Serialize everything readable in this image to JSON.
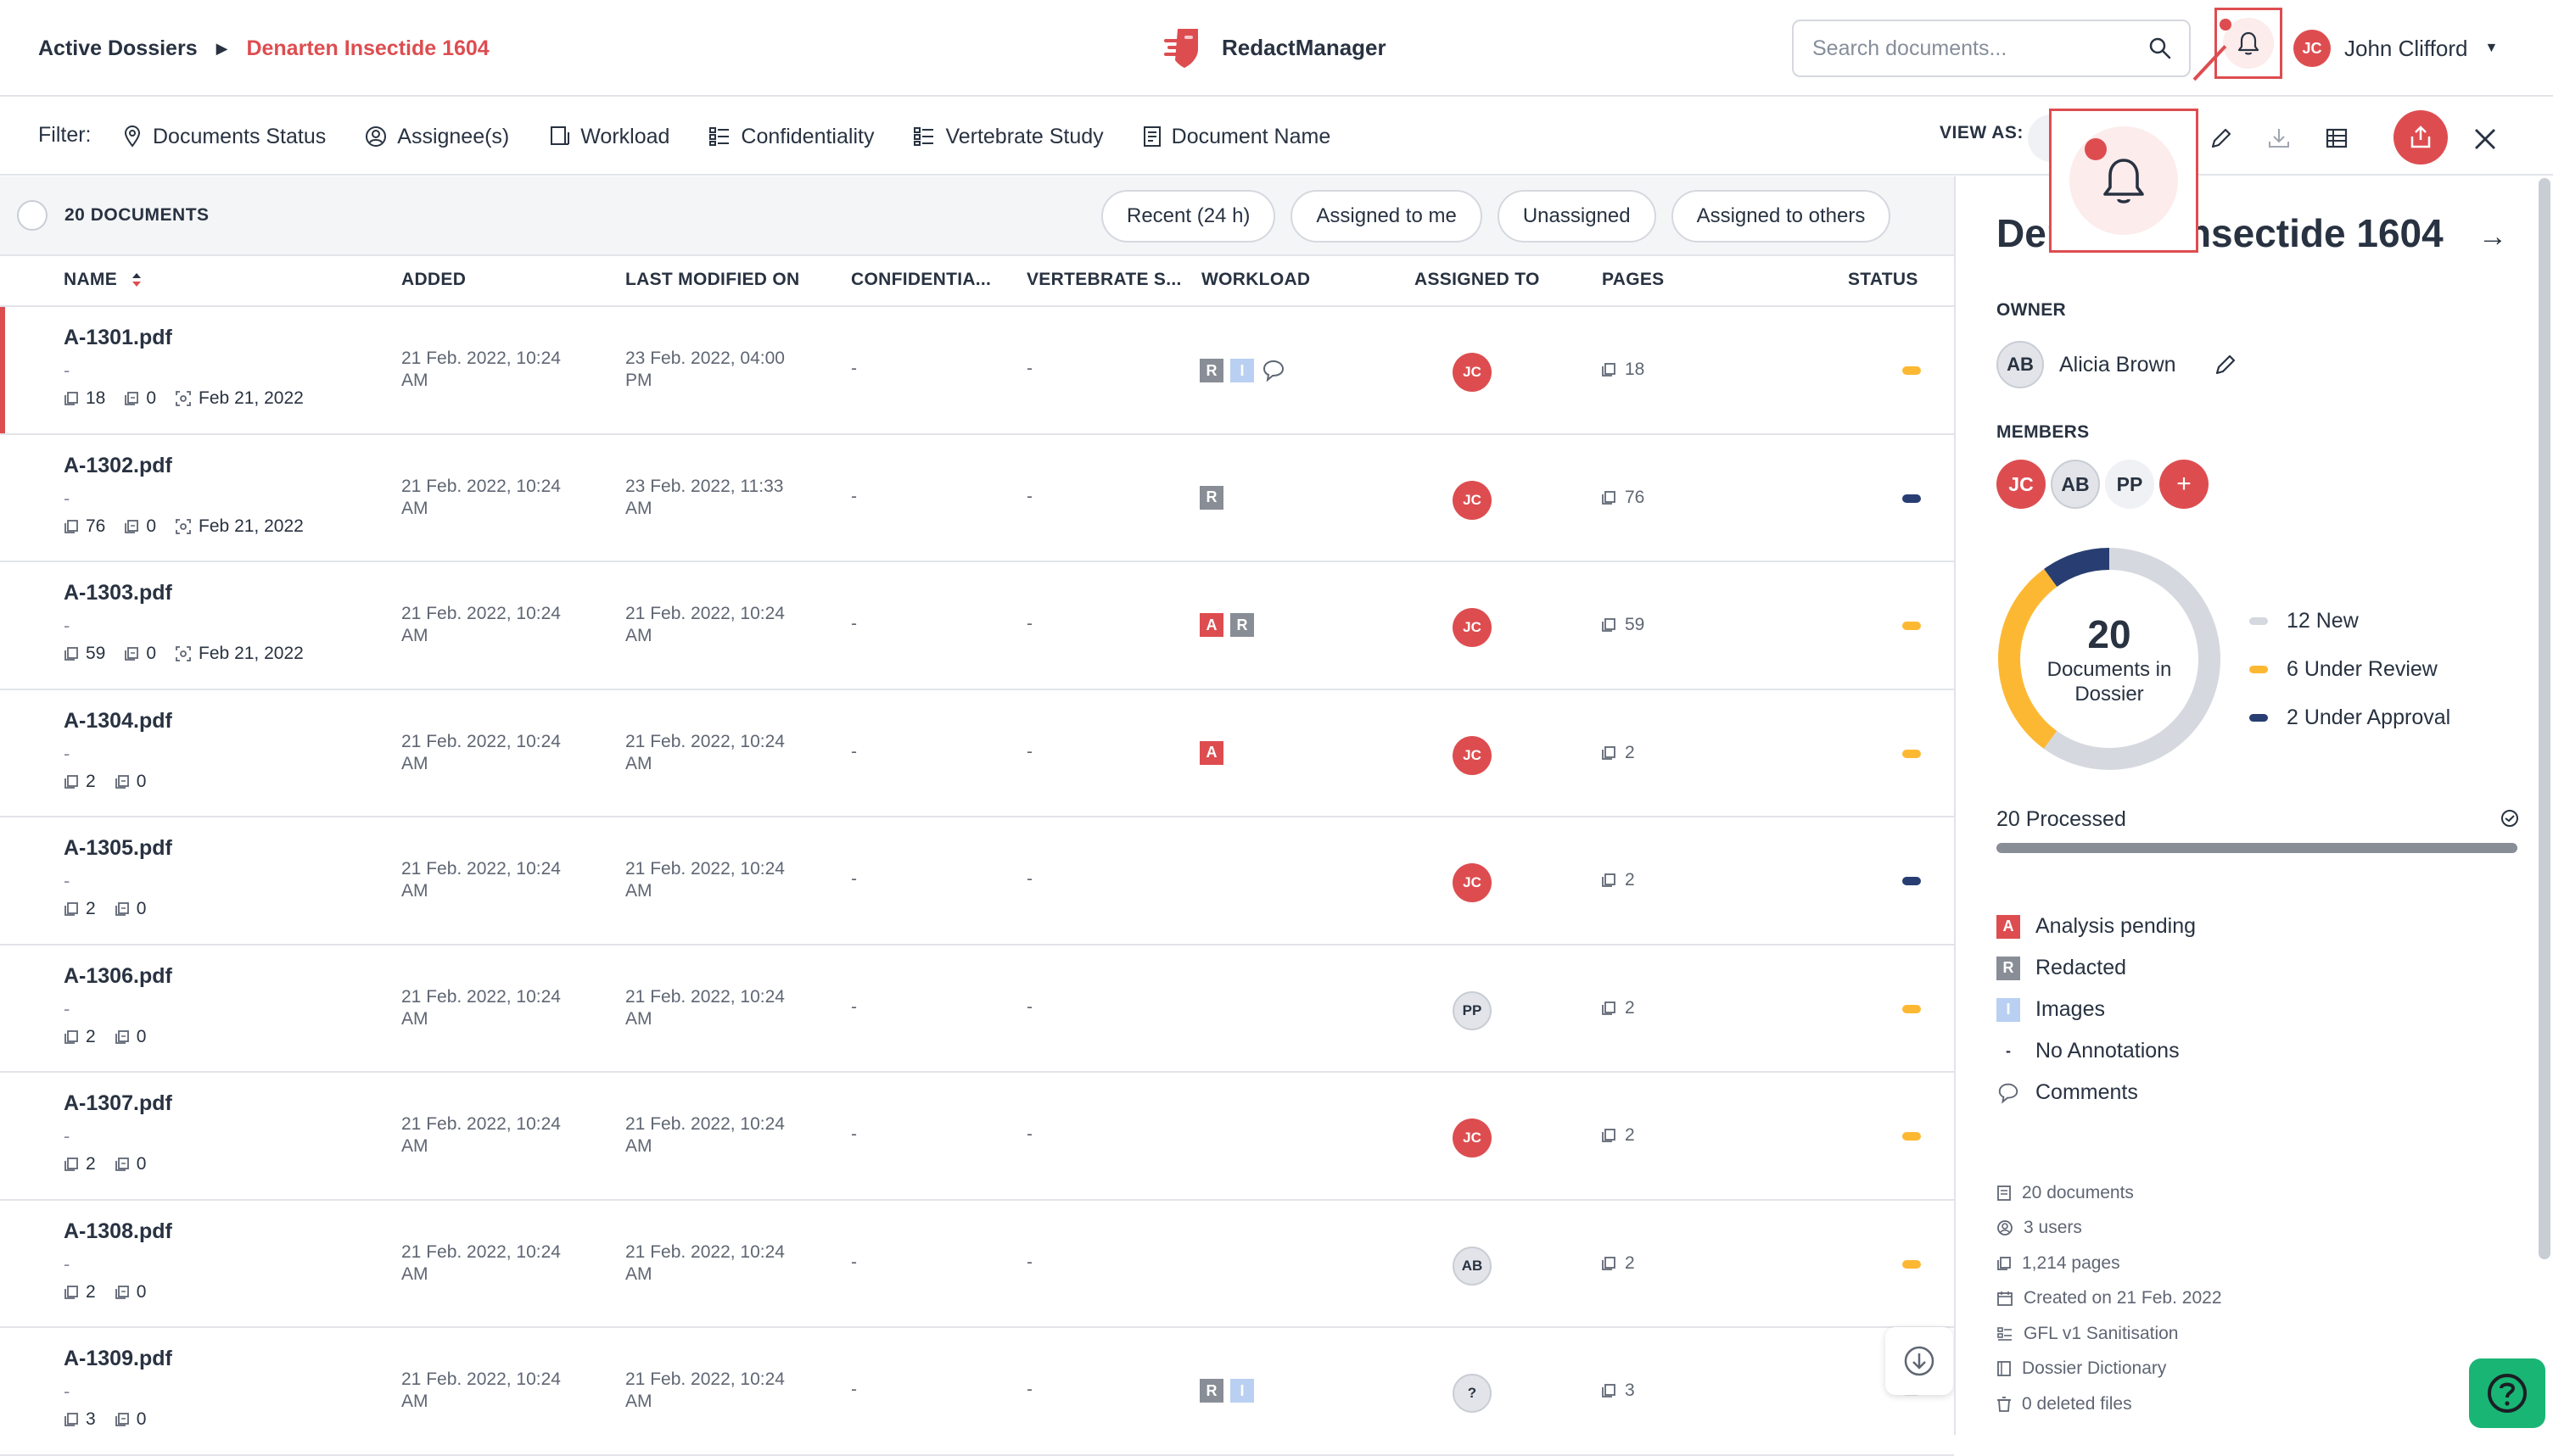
{
  "header": {
    "breadcrumb_root": "Active Dossiers",
    "breadcrumb_current": "Denarten Insectide 1604",
    "brand": "RedactManager",
    "search_placeholder": "Search documents...",
    "user_initials": "JC",
    "user_name": "John Clifford"
  },
  "filter_bar": {
    "label": "Filter:",
    "filters": [
      "Documents Status",
      "Assignee(s)",
      "Workload",
      "Confidentiality",
      "Vertebrate Study",
      "Document Name"
    ],
    "view_as_label": "VIEW AS:"
  },
  "list": {
    "count_label": "20 DOCUMENTS",
    "quick_filters": [
      "Recent (24 h)",
      "Assigned to me",
      "Unassigned",
      "Assigned to others"
    ],
    "columns": [
      "NAME",
      "ADDED",
      "LAST MODIFIED ON",
      "CONFIDENTIA...",
      "VERTEBRATE S...",
      "WORKLOAD",
      "ASSIGNED TO",
      "PAGES",
      "STATUS"
    ],
    "rows": [
      {
        "name": "A-1301.pdf",
        "dash": "-",
        "pages": "18",
        "annotations": "0",
        "ocr_date": "Feb 21, 2022",
        "added": "21 Feb. 2022, 10:24 AM",
        "modified": "23 Feb. 2022, 04:00 PM",
        "conf": "-",
        "vert": "-",
        "workload": [
          "R",
          "I",
          "comment"
        ],
        "assignee": "JC",
        "page_count": "18",
        "status_color": "#fdb833"
      },
      {
        "name": "A-1302.pdf",
        "dash": "-",
        "pages": "76",
        "annotations": "0",
        "ocr_date": "Feb 21, 2022",
        "added": "21 Feb. 2022, 10:24 AM",
        "modified": "23 Feb. 2022, 11:33 AM",
        "conf": "-",
        "vert": "-",
        "workload": [
          "R"
        ],
        "assignee": "JC",
        "page_count": "76",
        "status_color": "#283e72"
      },
      {
        "name": "A-1303.pdf",
        "dash": "-",
        "pages": "59",
        "annotations": "0",
        "ocr_date": "Feb 21, 2022",
        "added": "21 Feb. 2022, 10:24 AM",
        "modified": "21 Feb. 2022, 10:24 AM",
        "conf": "-",
        "vert": "-",
        "workload": [
          "A",
          "R"
        ],
        "assignee": "JC",
        "page_count": "59",
        "status_color": "#fdb833"
      },
      {
        "name": "A-1304.pdf",
        "dash": "-",
        "pages": "2",
        "annotations": "0",
        "ocr_date": "",
        "added": "21 Feb. 2022, 10:24 AM",
        "modified": "21 Feb. 2022, 10:24 AM",
        "conf": "-",
        "vert": "-",
        "workload": [
          "A"
        ],
        "assignee": "JC",
        "page_count": "2",
        "status_color": "#fdb833"
      },
      {
        "name": "A-1305.pdf",
        "dash": "-",
        "pages": "2",
        "annotations": "0",
        "ocr_date": "",
        "added": "21 Feb. 2022, 10:24 AM",
        "modified": "21 Feb. 2022, 10:24 AM",
        "conf": "-",
        "vert": "-",
        "workload": [],
        "assignee": "JC",
        "page_count": "2",
        "status_color": "#283e72"
      },
      {
        "name": "A-1306.pdf",
        "dash": "-",
        "pages": "2",
        "annotations": "0",
        "ocr_date": "",
        "added": "21 Feb. 2022, 10:24 AM",
        "modified": "21 Feb. 2022, 10:24 AM",
        "conf": "-",
        "vert": "-",
        "workload": [],
        "assignee": "PP",
        "page_count": "2",
        "status_color": "#fdb833"
      },
      {
        "name": "A-1307.pdf",
        "dash": "-",
        "pages": "2",
        "annotations": "0",
        "ocr_date": "",
        "added": "21 Feb. 2022, 10:24 AM",
        "modified": "21 Feb. 2022, 10:24 AM",
        "conf": "-",
        "vert": "-",
        "workload": [],
        "assignee": "JC",
        "page_count": "2",
        "status_color": "#fdb833"
      },
      {
        "name": "A-1308.pdf",
        "dash": "-",
        "pages": "2",
        "annotations": "0",
        "ocr_date": "",
        "added": "21 Feb. 2022, 10:24 AM",
        "modified": "21 Feb. 2022, 10:24 AM",
        "conf": "-",
        "vert": "-",
        "workload": [],
        "assignee": "AB",
        "page_count": "2",
        "status_color": "#fdb833"
      },
      {
        "name": "A-1309.pdf",
        "dash": "-",
        "pages": "3",
        "annotations": "0",
        "ocr_date": "",
        "added": "21 Feb. 2022, 10:24 AM",
        "modified": "21 Feb. 2022, 10:24 AM",
        "conf": "-",
        "vert": "-",
        "workload": [
          "R",
          "I"
        ],
        "assignee": "?",
        "page_count": "3",
        "status_color": "#e2e4e9"
      }
    ]
  },
  "panel": {
    "title": "Denarten Insectide 1604",
    "owner_label": "OWNER",
    "owner_initials": "AB",
    "owner_name": "Alicia Brown",
    "members_label": "MEMBERS",
    "members": [
      "JC",
      "AB",
      "PP"
    ],
    "add_member": "+",
    "donut_total": "20",
    "donut_label": "Documents in Dossier",
    "legend": [
      {
        "label": "12 New",
        "value": 12,
        "color": "#d5d8de"
      },
      {
        "label": "6 Under Review",
        "value": 6,
        "color": "#fdb833"
      },
      {
        "label": "2 Under Approval",
        "value": 2,
        "color": "#283e72"
      }
    ],
    "processed_label": "20 Processed",
    "processed_fraction": 1.0,
    "workload_legend": [
      {
        "key": "A",
        "label": "Analysis pending"
      },
      {
        "key": "R",
        "label": "Redacted"
      },
      {
        "key": "I",
        "label": "Images"
      },
      {
        "key": "-",
        "label": "No Annotations"
      },
      {
        "key": "comment",
        "label": "Comments"
      }
    ],
    "stats": [
      "20 documents",
      "3 users",
      "1,214 pages",
      "Created on 21 Feb. 2022",
      "GFL v1 Sanitisation",
      "Dossier Dictionary",
      "0 deleted files"
    ]
  }
}
